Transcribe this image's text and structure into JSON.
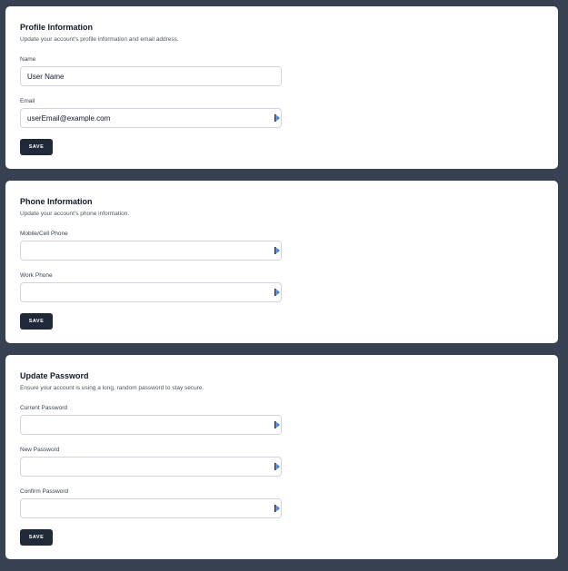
{
  "profile": {
    "title": "Profile Information",
    "description": "Update your account's profile information and email address.",
    "name_label": "Name",
    "name_value": "User Name",
    "email_label": "Email",
    "email_value": "userEmail@example.com",
    "save_label": "SAVE"
  },
  "phone": {
    "title": "Phone Information",
    "description": "Update your account's phone information.",
    "mobile_label": "Mobile/Cell Phone",
    "mobile_value": "",
    "work_label": "Work Phone",
    "work_value": "",
    "save_label": "SAVE"
  },
  "password": {
    "title": "Update Password",
    "description": "Ensure your account is using a long, random password to stay secure.",
    "current_label": "Current Password",
    "current_value": "",
    "new_label": "New Password",
    "new_value": "",
    "confirm_label": "Confirm Password",
    "confirm_value": "",
    "save_label": "SAVE"
  },
  "colors": {
    "background": "#374151",
    "card": "#ffffff",
    "button": "#1f2937",
    "autofill_icon": "#3b82f6"
  },
  "icons": {
    "input_autofill": "password-manager-icon"
  }
}
